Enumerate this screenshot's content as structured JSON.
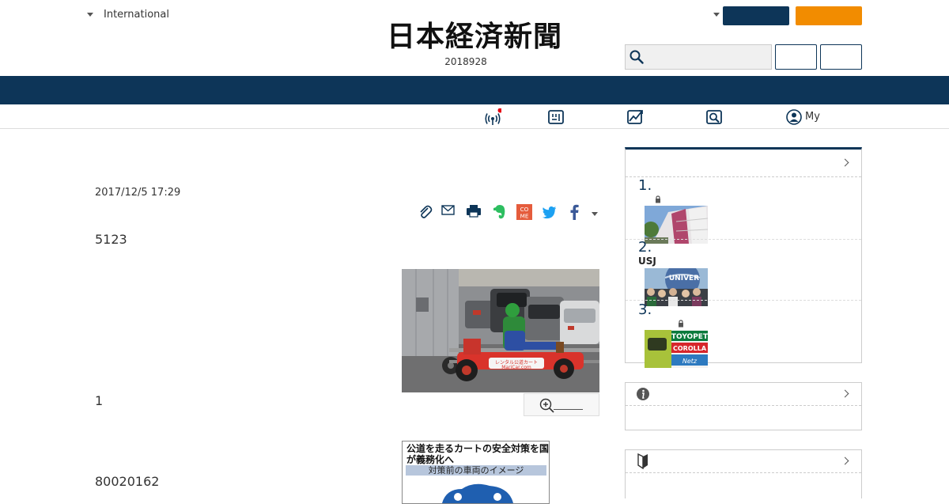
{
  "header": {
    "edition_label": "International",
    "logo_text": "日本経済新聞",
    "date": "2018928"
  },
  "subnav": {
    "my_label": "My"
  },
  "article": {
    "datetime": "2017/12/5 17:29",
    "paragraphs": [
      "5123",
      "1",
      "80020162"
    ],
    "graphic": {
      "title": "公道を走るカートの安全対策を国が義務化へ",
      "subtitle": "対策前の車両のイメージ"
    },
    "photo_caption_signs": {
      "kart_sign_1": "レンタル公道カート",
      "kart_sign_2": "MariCar.com",
      "toyopet": "TOYOPET",
      "corolla": "COROLLA",
      "nets": "Netz",
      "universal": "UNIVER"
    }
  },
  "sidebar": {
    "ranking": [
      {
        "rank": "1.",
        "sub": ""
      },
      {
        "rank": "2.",
        "sub": "USJ"
      },
      {
        "rank": "3.",
        "sub": ""
      }
    ]
  },
  "colors": {
    "navy": "#0d3558",
    "orange": "#f28c00",
    "live_dot": "#e60012"
  }
}
